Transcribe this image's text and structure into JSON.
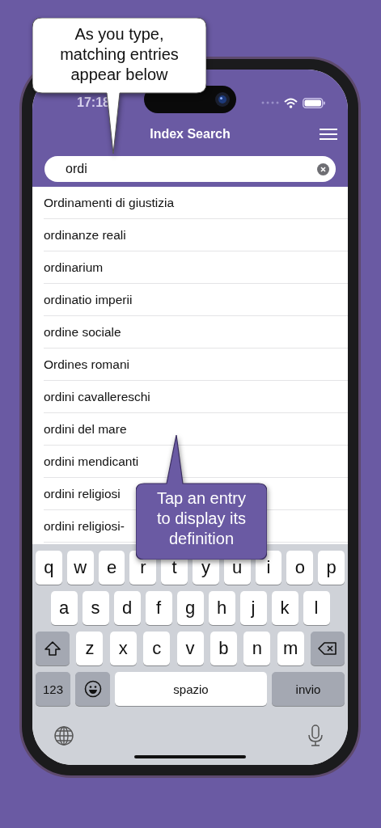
{
  "status_bar": {
    "time": "17:18"
  },
  "nav_bar": {
    "title": "Index Search"
  },
  "search": {
    "value": "ordi"
  },
  "results": [
    "Ordinamenti di giustizia",
    "ordinanze reali",
    "ordinarium",
    "ordinatio imperii",
    "ordine sociale",
    "Ordines romani",
    "ordini cavallereschi",
    "ordini del mare",
    "ordini mendicanti",
    "ordini religiosi",
    "ordini religiosi-"
  ],
  "keyboard": {
    "rows": [
      [
        {
          "kind": "letter",
          "label": "q"
        },
        {
          "kind": "letter",
          "label": "w"
        },
        {
          "kind": "letter",
          "label": "e"
        },
        {
          "kind": "letter",
          "label": "r"
        },
        {
          "kind": "letter",
          "label": "t"
        },
        {
          "kind": "letter",
          "label": "y"
        },
        {
          "kind": "letter",
          "label": "u"
        },
        {
          "kind": "letter",
          "label": "i"
        },
        {
          "kind": "letter",
          "label": "o"
        },
        {
          "kind": "letter",
          "label": "p"
        }
      ],
      [
        {
          "kind": "letter",
          "label": "a"
        },
        {
          "kind": "letter",
          "label": "s"
        },
        {
          "kind": "letter",
          "label": "d"
        },
        {
          "kind": "letter",
          "label": "f"
        },
        {
          "kind": "letter",
          "label": "g"
        },
        {
          "kind": "letter",
          "label": "h"
        },
        {
          "kind": "letter",
          "label": "j"
        },
        {
          "kind": "letter",
          "label": "k"
        },
        {
          "kind": "letter",
          "label": "l"
        }
      ],
      [
        {
          "kind": "shift"
        },
        {
          "kind": "letter",
          "label": "z"
        },
        {
          "kind": "letter",
          "label": "x"
        },
        {
          "kind": "letter",
          "label": "c"
        },
        {
          "kind": "letter",
          "label": "v"
        },
        {
          "kind": "letter",
          "label": "b"
        },
        {
          "kind": "letter",
          "label": "n"
        },
        {
          "kind": "letter",
          "label": "m"
        },
        {
          "kind": "delete"
        }
      ]
    ],
    "numbers_key": "123",
    "space_key": "spazio",
    "return_key": "invio"
  },
  "callouts": [
    {
      "kind": "light",
      "text": "As you type, matching entries appear below"
    },
    {
      "kind": "dark",
      "text": "Tap an entry to display its definition"
    }
  ]
}
